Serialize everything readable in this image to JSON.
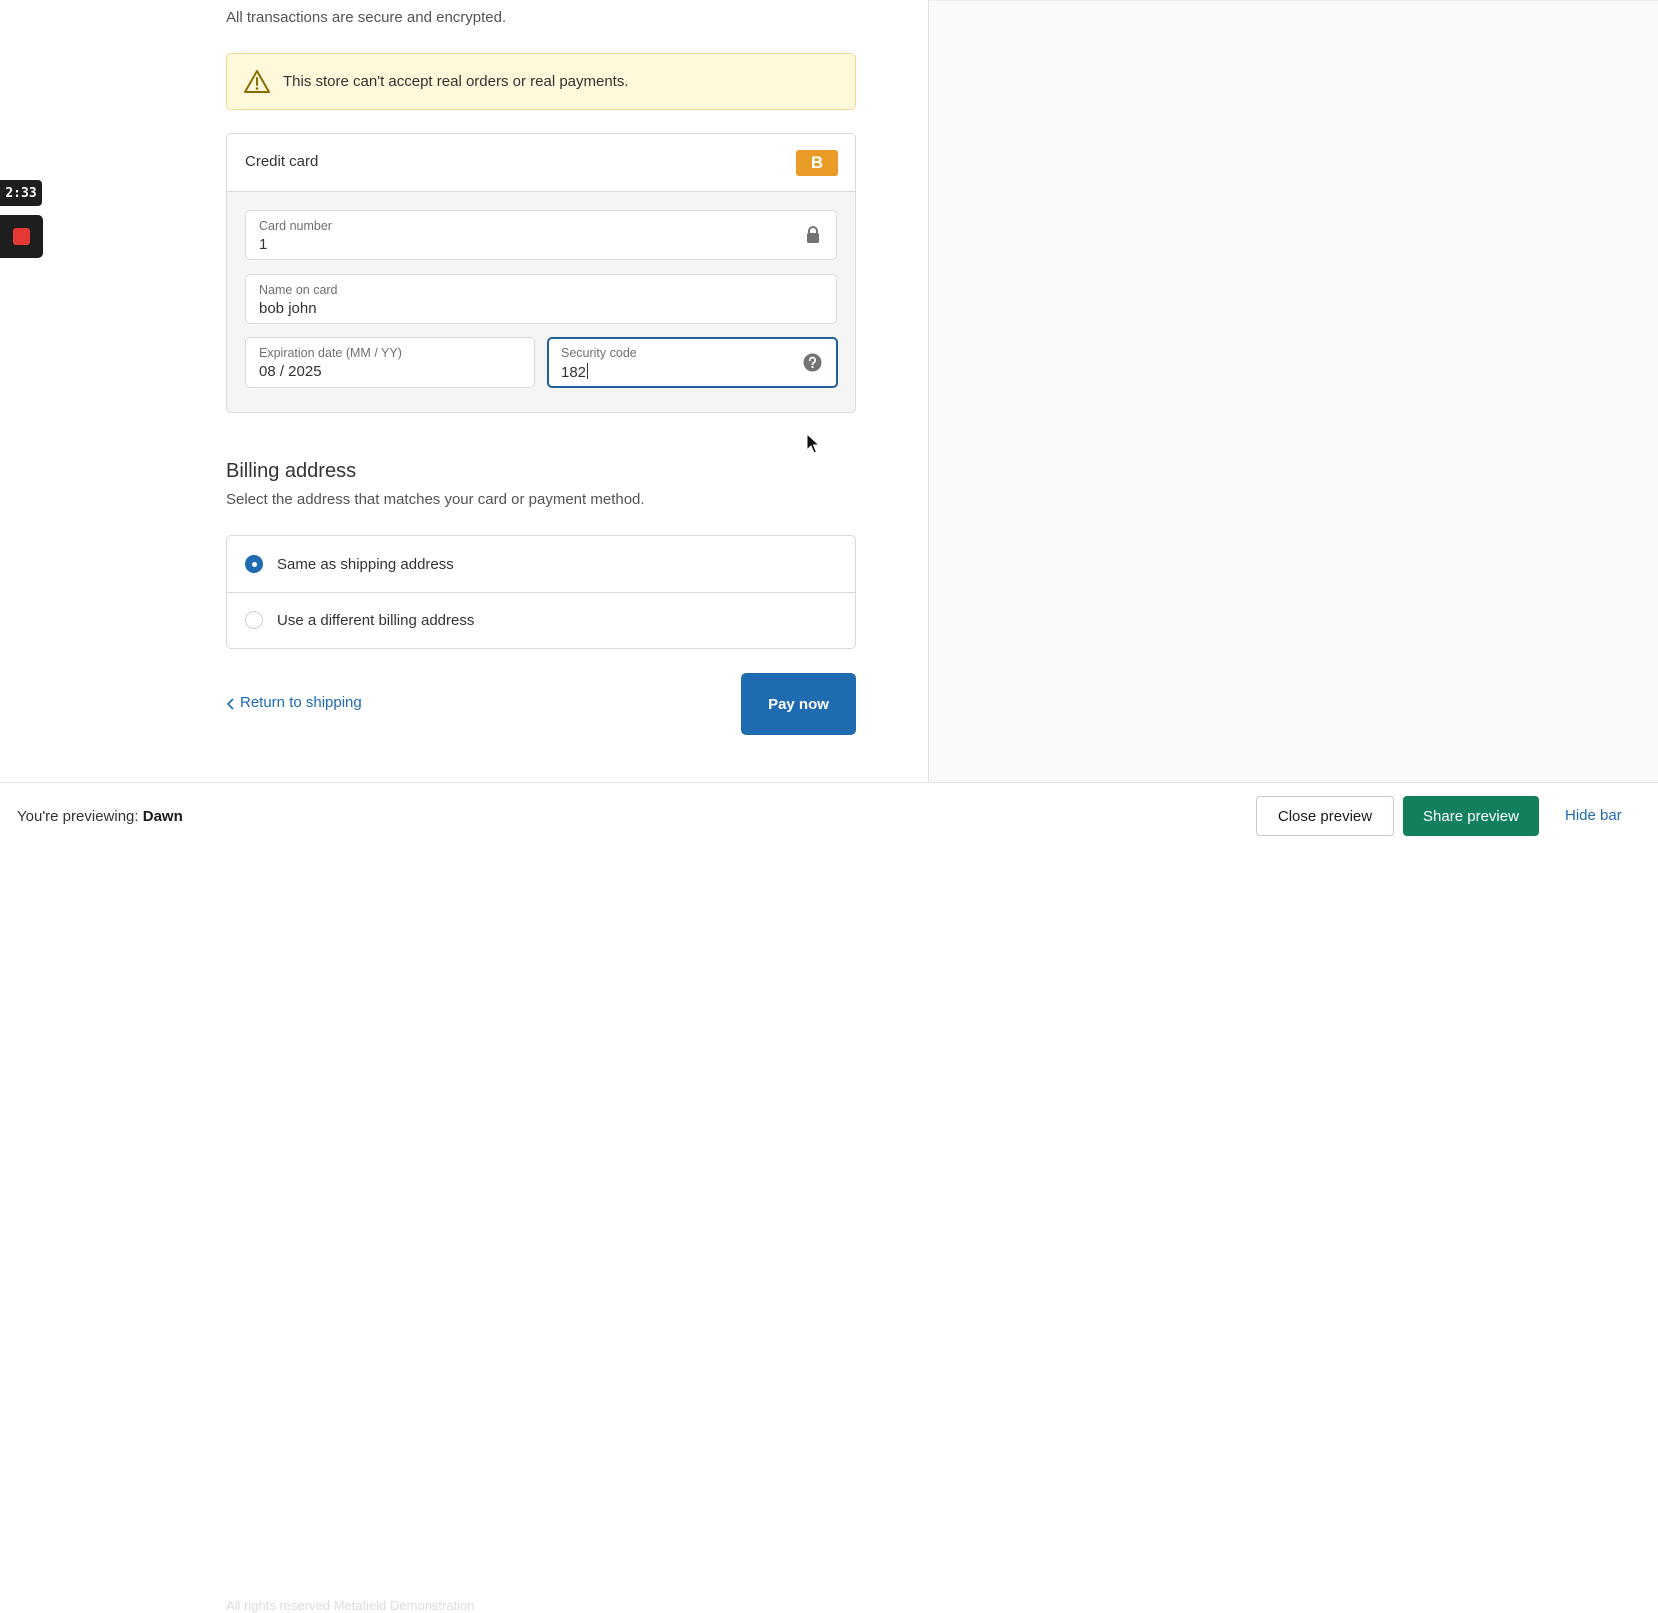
{
  "recorder": {
    "time": "2:33"
  },
  "checkout": {
    "secure_text": "All transactions are secure and encrypted.",
    "warning": "This store can't accept real orders or real payments.",
    "credit_card": {
      "title": "Credit card",
      "badge": "B",
      "card_number": {
        "label": "Card number",
        "value": "1"
      },
      "name_on_card": {
        "label": "Name on card",
        "value": "bob john"
      },
      "expiration": {
        "label": "Expiration date (MM / YY)",
        "value": "08 / 2025"
      },
      "security_code": {
        "label": "Security code",
        "value": "182"
      }
    },
    "billing": {
      "title": "Billing address",
      "subtitle": "Select the address that matches your card or payment method.",
      "options": [
        {
          "label": "Same as shipping address",
          "selected": true
        },
        {
          "label": "Use a different billing address",
          "selected": false
        }
      ]
    },
    "return_link": "Return to shipping",
    "pay_button": "Pay now",
    "footer_text": "All rights reserved Metafield Demonstration"
  },
  "preview_bar": {
    "previewing_label": "You're previewing:",
    "theme_name": "Dawn",
    "close_button": "Close preview",
    "share_button": "Share preview",
    "hide_link": "Hide bar"
  },
  "colors": {
    "accent": "#1f6bb0",
    "share_green": "#12805c",
    "warning_bg": "#fff8db",
    "badge_orange": "#e89b26",
    "record_red": "#e53935"
  }
}
